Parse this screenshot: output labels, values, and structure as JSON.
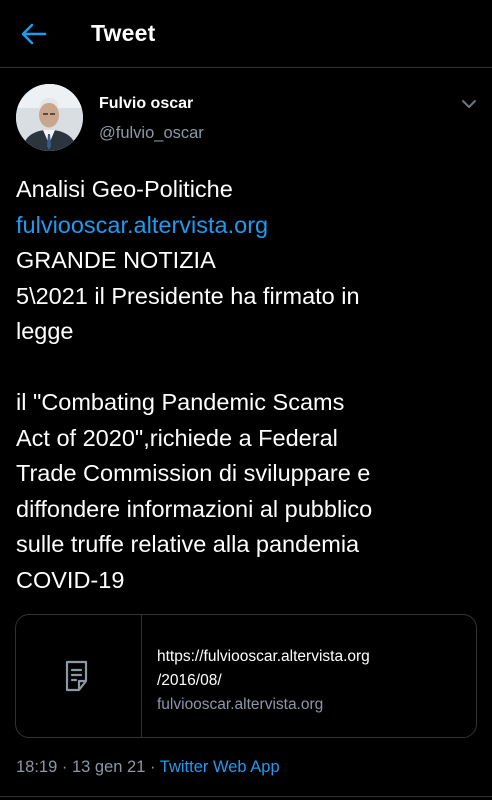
{
  "header": {
    "title": "Tweet",
    "back_icon": "arrow-left-icon"
  },
  "author": {
    "display_name": "Fulvio oscar",
    "handle": "@fulvio_oscar",
    "menu_icon": "chevron-down-icon"
  },
  "tweet": {
    "lines": [
      "Analisi Geo-Politiche",
      "fulviooscar.altervista.org",
      "GRANDE NOTIZIA",
      "5\\2021 il Presidente ha firmato in",
      "legge",
      "",
      "il \"Combating Pandemic Scams",
      "Act of 2020\",richiede a Federal",
      "Trade Commission di sviluppare e",
      "diffondere informazioni al pubblico",
      "sulle truffe relative alla pandemia",
      "COVID-19"
    ]
  },
  "card": {
    "icon": "document-icon",
    "url_line1": "https://fulviooscar.altervista.org",
    "url_line2": "/2016/08/",
    "domain": "fulviooscar.altervista.org"
  },
  "meta": {
    "time": "18:19",
    "separator": "·",
    "date": "13 gen 21",
    "source": "Twitter Web App"
  },
  "colors": {
    "background": "#000000",
    "accent": "#1d9bf0",
    "secondary_text": "#8b98a5",
    "border": "#2f3336"
  }
}
